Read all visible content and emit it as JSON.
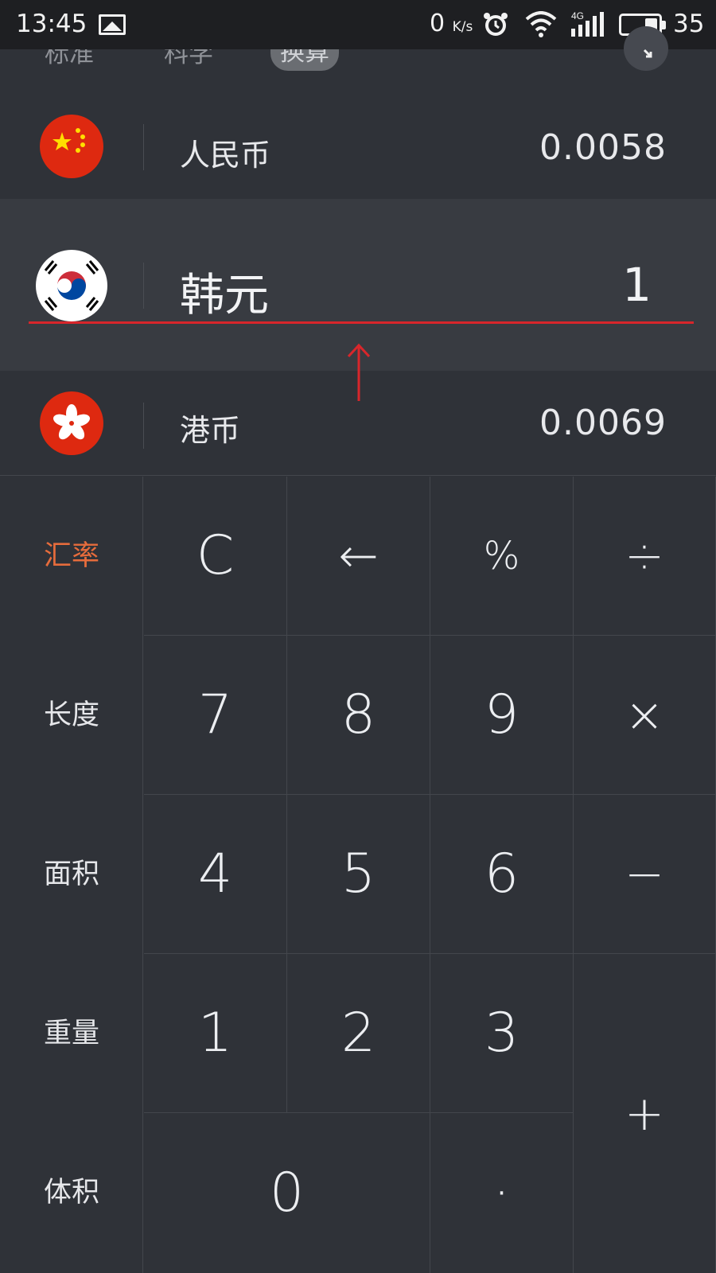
{
  "status_bar": {
    "time": "13:45",
    "net_speed": "0",
    "net_speed_unit": "K/s",
    "network": "4G",
    "battery": "35",
    "battery_level": 0.35
  },
  "tabs": [
    {
      "label": "标准",
      "active": false
    },
    {
      "label": "科学",
      "active": false
    },
    {
      "label": "换算",
      "active": true
    }
  ],
  "currencies": [
    {
      "name": "人民币",
      "value": "0.0058",
      "flag": "china-flag"
    },
    {
      "name": "韩元",
      "value": "1",
      "flag": "south-korea-flag",
      "selected": true
    },
    {
      "name": "港币",
      "value": "0.0069",
      "flag": "hong-kong-flag"
    }
  ],
  "categories": [
    {
      "label": "汇率",
      "active": true
    },
    {
      "label": "长度"
    },
    {
      "label": "面积"
    },
    {
      "label": "重量"
    },
    {
      "label": "体积"
    }
  ],
  "keys": {
    "clear": "C",
    "backspace": "←",
    "percent": "%",
    "divide": "÷",
    "seven": "7",
    "eight": "8",
    "nine": "9",
    "multiply": "×",
    "four": "4",
    "five": "5",
    "six": "6",
    "minus": "−",
    "one": "1",
    "two": "2",
    "three": "3",
    "plus": "+",
    "zero": "0",
    "dot": "·"
  },
  "colors": {
    "background": "#2f3238",
    "selected_row": "#383b41",
    "accent": "#e66c3c",
    "annotation_red": "#d8262b"
  }
}
